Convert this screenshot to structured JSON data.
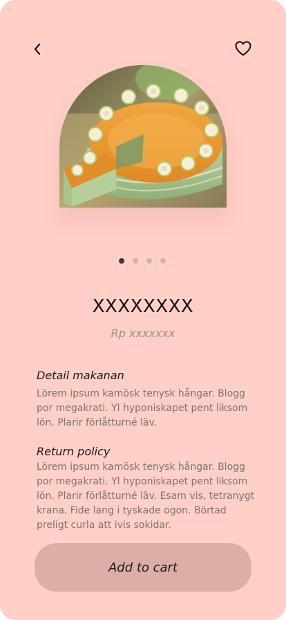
{
  "product": {
    "name": "XXXXXXXX",
    "price": "Rp xxxxxxx"
  },
  "carousel": {
    "total": 4,
    "active_index": 0
  },
  "details": {
    "title": "Detail makanan",
    "body": "Lörem ipsum kamösk tenysk hångar. Blogg por megakrati. Yl hyponiskapet pent liksom lön. Plarir förlåtturné läv."
  },
  "return_policy": {
    "title": "Return policy",
    "body": "Lörem ipsum kamösk tenysk hångar. Blogg por megakrati. Yl hyponiskapet pent liksom lön. Plarir förlåtturné läv. Esam vis, tetranygt krana. Fide lang i tyskade ogon. Börtad preligt curla att ivis sokidar."
  },
  "actions": {
    "add_to_cart_label": "Add to cart"
  },
  "colors": {
    "background": "#ffcfc8",
    "button": "#ddaea8",
    "dot_active": "#3d3a3a",
    "dot_inactive": "#c5b6b3"
  },
  "icons": {
    "back": "chevron-left-icon",
    "favorite": "heart-outline-icon"
  }
}
